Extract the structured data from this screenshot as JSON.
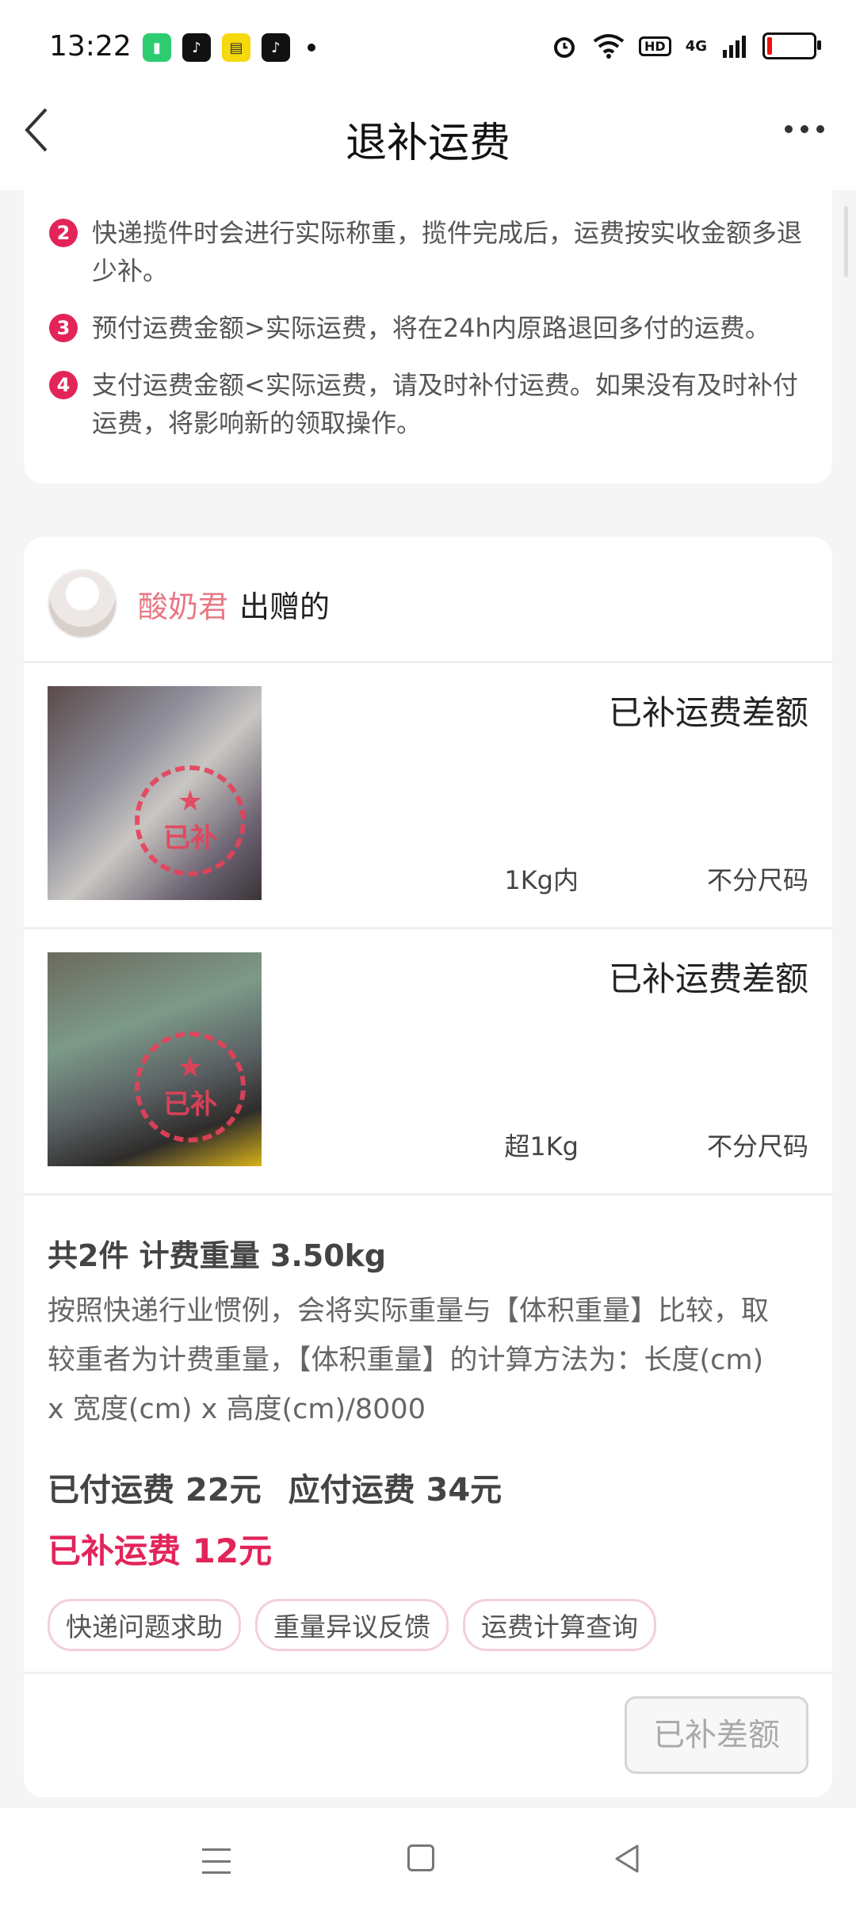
{
  "status_bar": {
    "time": "13:22",
    "hd_label": "HD",
    "network_label": "4G"
  },
  "header": {
    "title": "退补运费"
  },
  "rules": [
    {
      "num": "2",
      "text": "快递揽件时会进行实际称重，揽件完成后，运费按实收金额多退少补。"
    },
    {
      "num": "3",
      "text": "预付运费金额>实际运费，将在24h内原路退回多付的运费。"
    },
    {
      "num": "4",
      "text": "支付运费金额<实际运费，请及时补付运费。如果没有及时补付运费，将影响新的领取操作。"
    }
  ],
  "giver": {
    "name": "酸奶君",
    "suffix": "出赠的"
  },
  "stamp_label": "已补",
  "items": [
    {
      "title": "已补运费差额",
      "weight": "1Kg内",
      "size": "不分尺码"
    },
    {
      "title": "已补运费差额",
      "weight": "超1Kg",
      "size": "不分尺码"
    }
  ],
  "summary": {
    "title": "共2件 计费重量 3.50kg",
    "desc": "按照快递行业惯例，会将实际重量与【体积重量】比较，取较重者为计费重量，【体积重量】的计算方法为：长度(cm) x 宽度(cm) x 高度(cm)/8000",
    "paid": "已付运费 22元",
    "due": "应付运费 34元",
    "supplement": "已补运费 12元"
  },
  "tags": [
    "快递问题求助",
    "重量异议反馈",
    "运费计算查询"
  ],
  "action_button": "已补差额",
  "colors": {
    "accent": "#e2245a",
    "giver_name": "#e77884"
  }
}
